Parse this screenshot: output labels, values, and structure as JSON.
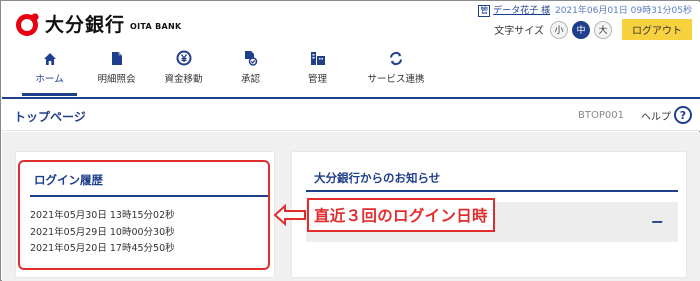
{
  "header": {
    "bank_name": "大分銀行",
    "bank_name_en": "OITA BANK",
    "user_badge": "管",
    "user_name": "データ花子 様",
    "last_login": "2021年06月01日 09時31分05秒",
    "font_size_label": "文字サイズ",
    "font_sizes": [
      {
        "label": "小",
        "active": false
      },
      {
        "label": "中",
        "active": true
      },
      {
        "label": "大",
        "active": false
      }
    ],
    "logout_label": "ログアウト"
  },
  "nav": {
    "items": [
      {
        "label": "ホーム",
        "icon": "home-icon",
        "active": true
      },
      {
        "label": "明細照会",
        "icon": "document-icon",
        "active": false
      },
      {
        "label": "資金移動",
        "icon": "yen-transfer-icon",
        "active": false
      },
      {
        "label": "承認",
        "icon": "approval-icon",
        "active": false
      },
      {
        "label": "管理",
        "icon": "management-icon",
        "active": false
      },
      {
        "label": "サービス連携",
        "icon": "service-link-icon",
        "active": false
      }
    ]
  },
  "page": {
    "title": "トップページ",
    "page_id": "BTOP001",
    "help_label": "ヘルプ",
    "help_icon": "?"
  },
  "login_history": {
    "title": "ログイン履歴",
    "entries": [
      "2021年05月30日 13時15分02秒",
      "2021年05月29日 10時00分30秒",
      "2021年05月20日 17時45分50秒"
    ]
  },
  "notices": {
    "title": "大分銀行からのお知らせ",
    "collapse_symbol": "−"
  },
  "annotation": {
    "text": "直近３回のログイン日時"
  },
  "colors": {
    "brand_navy": "#1f3e8c",
    "logo_red": "#e60012",
    "logout_yellow": "#f7d23e",
    "highlight_red": "#e02e2e"
  }
}
